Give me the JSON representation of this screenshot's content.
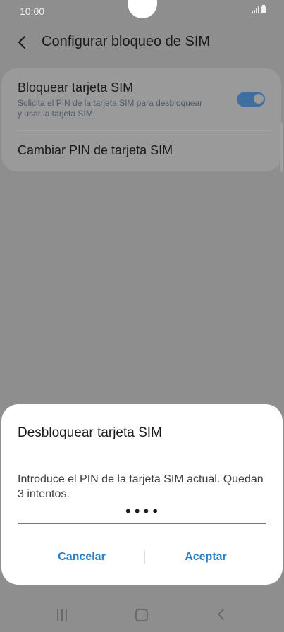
{
  "status_bar": {
    "time": "10:00"
  },
  "header": {
    "title": "Configurar bloqueo de SIM"
  },
  "settings": {
    "lock_sim": {
      "title": "Bloquear tarjeta SIM",
      "description": "Solicita el PIN de la tarjeta SIM para desbloquear y usar la tarjeta SIM.",
      "enabled": true
    },
    "change_pin": {
      "title": "Cambiar PIN de tarjeta SIM"
    }
  },
  "dialog": {
    "title": "Desbloquear tarjeta SIM",
    "message": "Introduce el PIN de la tarjeta SIM actual. Quedan 3 intentos.",
    "pin_value": "••••",
    "cancel_label": "Cancelar",
    "accept_label": "Aceptar"
  },
  "colors": {
    "accent": "#2a7fc7",
    "toggle_on": "#3f6ea3",
    "overlay_bg": "#8e8e8e"
  },
  "icons": {
    "back": "chevron-left-icon",
    "signal": "signal-icon",
    "battery": "battery-icon",
    "nav_recents": "recents-icon",
    "nav_home": "home-icon",
    "nav_back": "back-icon"
  }
}
